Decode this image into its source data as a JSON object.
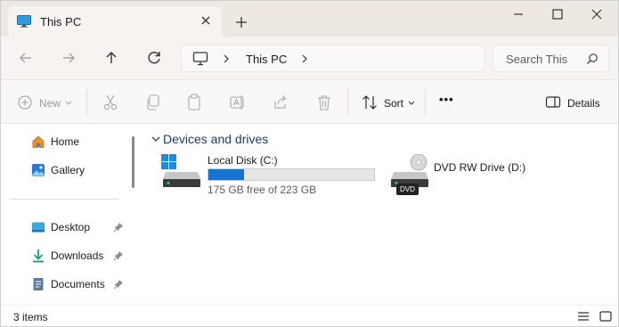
{
  "window": {
    "tab_title": "This PC",
    "icons": {
      "tab": "monitor-icon",
      "close_tab": "close-icon",
      "new_tab": "plus-icon",
      "minimize": "minimize-icon",
      "maximize": "maximize-icon",
      "close": "close-icon"
    }
  },
  "nav": {
    "icons": [
      "back-arrow-icon",
      "forward-arrow-icon",
      "up-arrow-icon",
      "refresh-icon"
    ],
    "breadcrumb": [
      "This PC"
    ],
    "search_placeholder": "Search This"
  },
  "toolbar": {
    "new_label": "New",
    "sort_label": "Sort",
    "details_label": "Details",
    "more_label": "•••",
    "icons": [
      "cut-icon",
      "copy-icon",
      "paste-icon",
      "rename-icon",
      "share-icon",
      "delete-icon"
    ]
  },
  "sidebar": {
    "items": [
      {
        "label": "Home",
        "icon": "home-icon",
        "pinned": false
      },
      {
        "label": "Gallery",
        "icon": "gallery-icon",
        "pinned": false
      },
      {
        "label": "Desktop",
        "icon": "desktop-icon",
        "pinned": true
      },
      {
        "label": "Downloads",
        "icon": "download-icon",
        "pinned": true
      },
      {
        "label": "Documents",
        "icon": "document-icon",
        "pinned": true
      }
    ]
  },
  "content": {
    "group_title": "Devices and drives",
    "drives": [
      {
        "name": "Local Disk (C:)",
        "free_text": "175 GB free of 223 GB",
        "used_fraction": 0.215,
        "icon": "windows-drive-icon"
      },
      {
        "name": "DVD RW Drive (D:)",
        "badge": "DVD",
        "icon": "dvd-drive-icon"
      }
    ]
  },
  "status": {
    "items_text": "3 items"
  },
  "colors": {
    "accent": "#1674d1",
    "group_title": "#1f3a68",
    "titlebar": "#eee8e3"
  }
}
